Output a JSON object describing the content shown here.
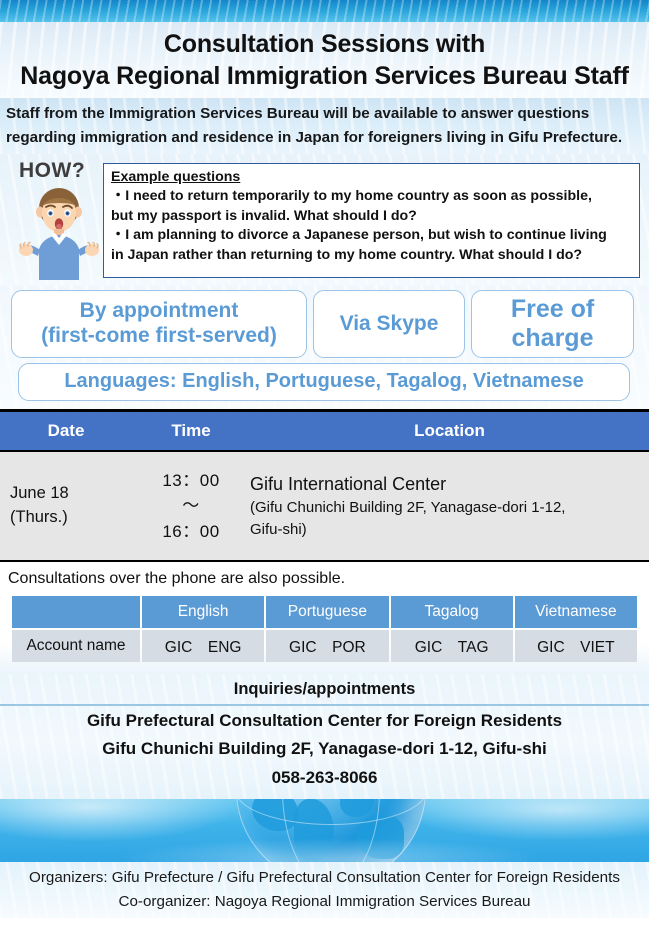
{
  "header": {
    "title_line1": "Consultation Sessions with",
    "title_line2": "Nagoya Regional Immigration Services Bureau Staff",
    "subtitle_line1": "Staff from the Immigration Services Bureau will be available to answer questions",
    "subtitle_line2": "regarding immigration and residence in Japan for foreigners living in Gifu Prefecture."
  },
  "how": {
    "label": "HOW?",
    "box_title": "Example questions",
    "question1_line1": "・I need to return temporarily to my home country as soon as possible,",
    "question1_line2": "but my passport is invalid. What should I do?",
    "question2_line1": "・I am planning to divorce a Japanese person, but wish to continue living",
    "question2_line2": "in Japan rather than returning to my home country. What should I do?"
  },
  "features": {
    "appointment_line1": "By appointment",
    "appointment_line2": "(first-come first-served)",
    "skype": "Via Skype",
    "free_line1": "Free of",
    "free_line2": "charge",
    "languages": "Languages: English, Portuguese, Tagalog, Vietnamese",
    "accent_color": "#5b9bd5",
    "border_color": "#9dc3e6"
  },
  "schedule": {
    "headers": [
      "Date",
      "Time",
      "Location"
    ],
    "header_bg": "#4472c4",
    "row_bg": "#e7e6e6",
    "rows": [
      {
        "date_line1": "June 18",
        "date_line2": "(Thurs.)",
        "time_start": "13：00",
        "time_sep": "～",
        "time_end": "16：00",
        "location_name": "Gifu International Center",
        "location_address_line1": "(Gifu Chunichi Building 2F, Yanagase-dori 1-12,",
        "location_address_line2": "Gifu-shi)"
      }
    ]
  },
  "phone": {
    "note": "Consultations over the phone are also possible.",
    "table": {
      "header_bg": "#5b9bd5",
      "cell_bg": "#d6dce4",
      "corner_label": "",
      "columns": [
        "English",
        "Portuguese",
        "Tagalog",
        "Vietnamese"
      ],
      "row_label": "Account name",
      "accounts": [
        "GIC　ENG",
        "GIC　POR",
        "GIC　TAG",
        "GIC　VIET"
      ]
    }
  },
  "inquiries": {
    "title": "Inquiries/appointments",
    "org_name": "Gifu Prefectural Consultation Center for Foreign Residents",
    "address": "Gifu Chunichi Building 2F, Yanagase-dori 1-12, Gifu-shi",
    "phone_number": "058-263-8066"
  },
  "footer": {
    "organizers": "Organizers: Gifu Prefecture / Gifu Prefectural Consultation Center for Foreign Residents",
    "co_organizer": "Co-organizer: Nagoya Regional Immigration Services Bureau"
  }
}
